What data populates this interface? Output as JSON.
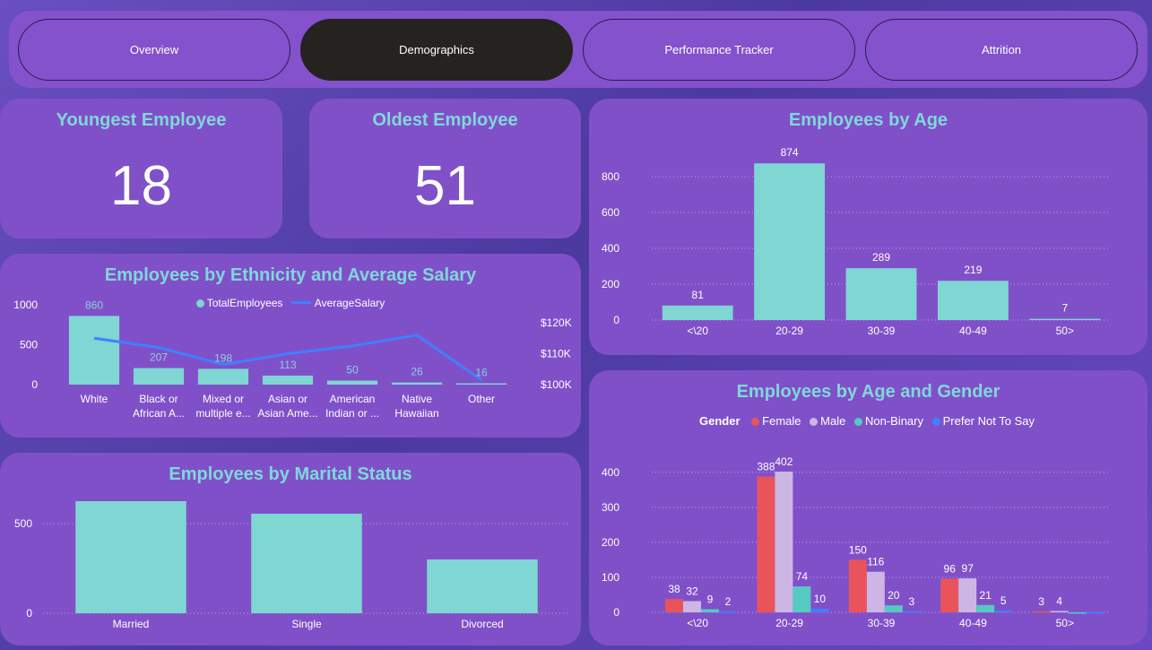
{
  "nav": {
    "tabs": [
      {
        "label": "Overview",
        "active": false
      },
      {
        "label": "Demographics",
        "active": true
      },
      {
        "label": "Performance Tracker",
        "active": false
      },
      {
        "label": "Attrition",
        "active": false
      }
    ]
  },
  "kpis": {
    "youngest": {
      "title": "Youngest Employee",
      "value": "18"
    },
    "oldest": {
      "title": "Oldest Employee",
      "value": "51"
    }
  },
  "colors": {
    "teal": "#7fd6d3",
    "line": "#3f80ff",
    "title": "#7fd8d8",
    "female": "#e8545a",
    "male": "#cdb6e6",
    "nonbinary": "#56c9c0",
    "prefer_not": "#3f80ff"
  },
  "chart_data": [
    {
      "id": "ethnicity",
      "type": "bar",
      "title": "Employees by Ethnicity and Average Salary",
      "categories": [
        "White",
        "Black or African A...",
        "Mixed or multiple e...",
        "Asian or Asian Ame...",
        "American Indian or ...",
        "Native Hawaiian",
        "Other"
      ],
      "category_lines": [
        [
          "White"
        ],
        [
          "Black or",
          "African A..."
        ],
        [
          "Mixed or",
          "multiple e..."
        ],
        [
          "Asian or",
          "Asian Ame..."
        ],
        [
          "American",
          "Indian or ..."
        ],
        [
          "Native",
          "Hawaiian"
        ],
        [
          "Other"
        ]
      ],
      "series": [
        {
          "name": "TotalEmployees",
          "kind": "bar",
          "values": [
            860,
            207,
            198,
            113,
            50,
            26,
            16
          ]
        },
        {
          "name": "AverageSalary",
          "kind": "line",
          "axis": "right",
          "values": [
            115000,
            112000,
            106500,
            110000,
            112500,
            116000,
            101500
          ]
        }
      ],
      "y_ticks": [
        0,
        500,
        1000
      ],
      "ylim": [
        0,
        1100
      ],
      "y2_ticks": [
        "$100K",
        "$110K",
        "$120K"
      ],
      "y2_tick_values": [
        100000,
        110000,
        120000
      ],
      "y2lim": [
        100000,
        120000
      ],
      "legend": "top-center"
    },
    {
      "id": "age",
      "type": "bar",
      "title": "Employees by Age",
      "categories": [
        "<\\20",
        "20-29",
        "30-39",
        "40-49",
        "50>"
      ],
      "values": [
        81,
        874,
        289,
        219,
        7
      ],
      "y_ticks": [
        0,
        200,
        400,
        600,
        800
      ],
      "ylim": [
        0,
        900
      ],
      "grid": true
    },
    {
      "id": "marital",
      "type": "bar",
      "title": "Employees by Marital Status",
      "categories": [
        "Married",
        "Single",
        "Divorced"
      ],
      "values": [
        625,
        555,
        300
      ],
      "y_ticks": [
        0,
        500
      ],
      "ylim": [
        0,
        700
      ],
      "grid": true
    },
    {
      "id": "age_gender",
      "type": "bar",
      "title": "Employees by Age and Gender",
      "legend_title": "Gender",
      "categories": [
        "<\\20",
        "20-29",
        "30-39",
        "40-49",
        "50>"
      ],
      "series": [
        {
          "name": "Female",
          "values": [
            38,
            388,
            150,
            96,
            3
          ]
        },
        {
          "name": "Male",
          "values": [
            32,
            402,
            116,
            97,
            4
          ]
        },
        {
          "name": "Non-Binary",
          "values": [
            9,
            74,
            20,
            21,
            0
          ]
        },
        {
          "name": "Prefer Not To Say",
          "values": [
            2,
            10,
            3,
            5,
            0
          ]
        }
      ],
      "series_labels": [
        [
          "38",
          "388",
          "150",
          "96",
          "3"
        ],
        [
          "32",
          "402",
          "116",
          "97",
          "4"
        ],
        [
          "9",
          "74",
          "20",
          "21",
          ""
        ],
        [
          "2",
          "10",
          "3",
          "5",
          ""
        ]
      ],
      "y_ticks": [
        0,
        100,
        200,
        300,
        400
      ],
      "ylim": [
        0,
        420
      ],
      "grid": true,
      "legend": "top-center"
    }
  ]
}
